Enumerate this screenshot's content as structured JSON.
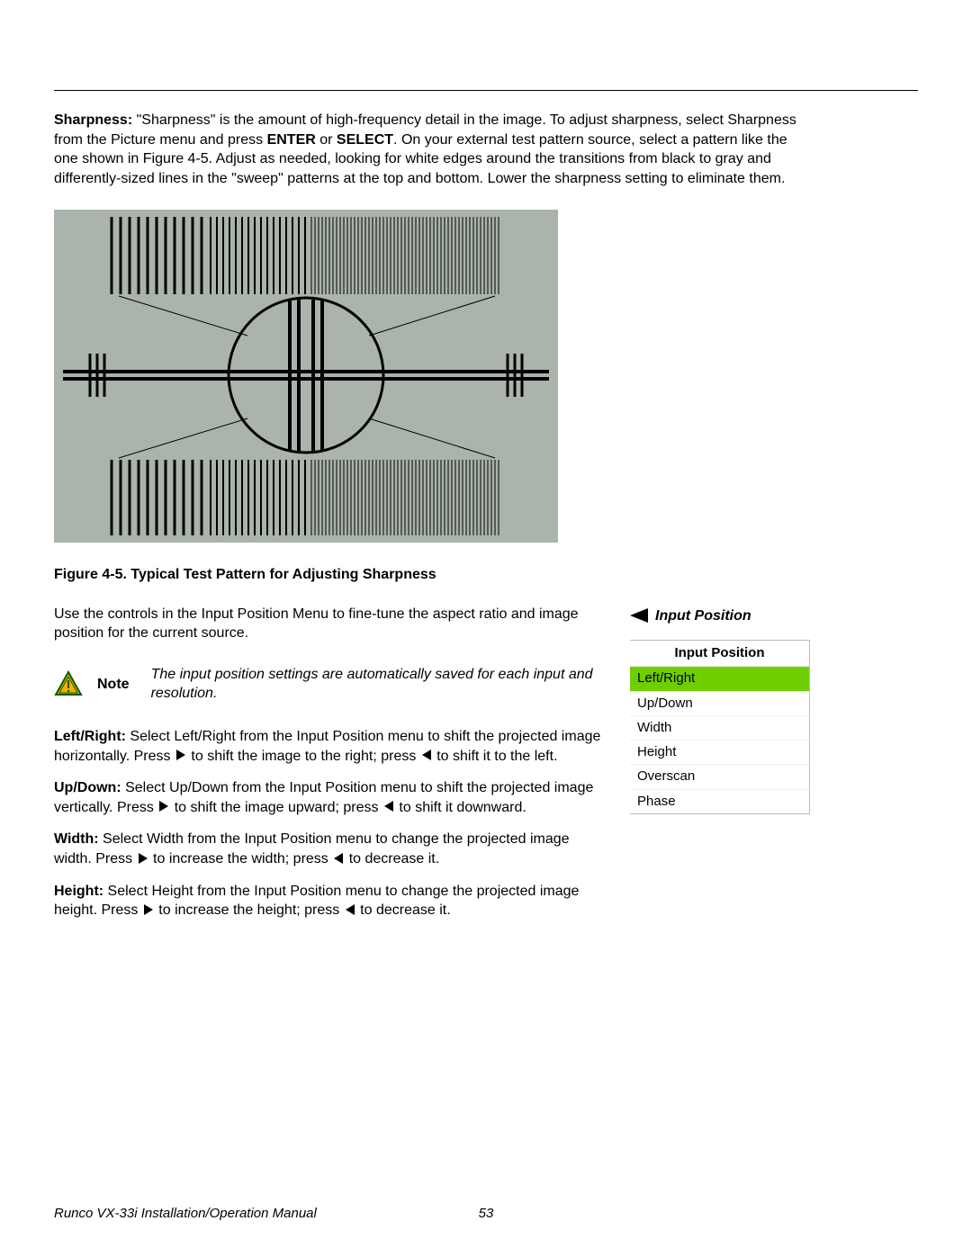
{
  "sharpness": {
    "heading": "Sharpness:",
    "body_1": " \"Sharpness\" is the amount of high-frequency detail in the image. To adjust sharpness, select Sharpness from the Picture menu and press ",
    "bold_1": "ENTER",
    "mid_1": " or ",
    "bold_2": "SELECT",
    "body_2": ". On your external test pattern source, select a pattern like the one shown in Figure 4-5. Adjust as needed, looking for white edges around the transitions from black to gray and differently-sized lines in the \"sweep\" patterns at the top and bottom. Lower the sharpness setting to eliminate them."
  },
  "figure_caption": "Figure 4-5. Typical Test Pattern for Adjusting Sharpness",
  "intro_para": "Use the controls in the Input Position Menu to fine-tune the aspect ratio and image position for the current source.",
  "note": {
    "label": "Note",
    "text": "The input position settings are automatically saved for each input and resolution."
  },
  "sections": {
    "leftright": {
      "heading": "Left/Right:",
      "t1": " Select Left/Right from the Input Position menu to shift the projected image horizontally. Press ",
      "t2": " to shift the image to the right; press ",
      "t3": " to shift it to the left."
    },
    "updown": {
      "heading": "Up/Down:",
      "t1": " Select Up/Down from the Input Position menu to shift the projected image vertically. Press ",
      "t2": " to shift the image upward; press ",
      "t3": " to shift it downward."
    },
    "width": {
      "heading": "Width:",
      "t1": " Select Width from the Input Position menu to change the projected image width. Press ",
      "t2": " to increase the width; press ",
      "t3": " to decrease it."
    },
    "height": {
      "heading": "Height:",
      "t1": " Select Height from the Input Position menu to change the projected image height. Press ",
      "t2": " to increase the height; press ",
      "t3": " to decrease it."
    }
  },
  "sidebar": {
    "heading": "Input Position",
    "menu_title": "Input Position",
    "items": [
      {
        "label": "Left/Right",
        "selected": true
      },
      {
        "label": "Up/Down",
        "selected": false
      },
      {
        "label": "Width",
        "selected": false
      },
      {
        "label": "Height",
        "selected": false
      },
      {
        "label": "Overscan",
        "selected": false
      },
      {
        "label": "Phase",
        "selected": false
      }
    ]
  },
  "footer": {
    "title": "Runco VX-33i Installation/Operation Manual",
    "page": "53"
  }
}
